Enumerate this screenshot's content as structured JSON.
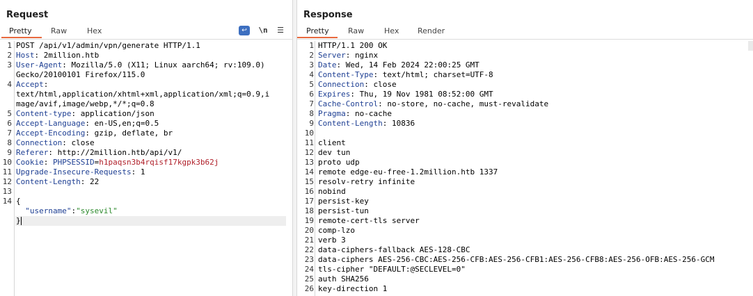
{
  "request": {
    "title": "Request",
    "tabs": [
      "Pretty",
      "Raw",
      "Hex"
    ],
    "active_tab": "Pretty",
    "tools": {
      "wrap_icon": "word-wrap-icon",
      "newline_label": "\\n",
      "menu_icon": "hamburger-menu-icon"
    },
    "lines": [
      {
        "n": "1",
        "text": "POST /api/v1/admin/vpn/generate HTTP/1.1"
      },
      {
        "n": "2",
        "key": "Host",
        "val": "2million.htb"
      },
      {
        "n": "3",
        "key": "User-Agent",
        "val": "Mozilla/5.0 (X11; Linux aarch64; rv:109.0)"
      },
      {
        "n": "",
        "text": "Gecko/20100101 Firefox/115.0"
      },
      {
        "n": "4",
        "key": "Accept",
        "val": ""
      },
      {
        "n": "",
        "text": "text/html,application/xhtml+xml,application/xml;q=0.9,i"
      },
      {
        "n": "",
        "text": "mage/avif,image/webp,*/*;q=0.8"
      },
      {
        "n": "5",
        "key": "Content-type",
        "val": "application/json"
      },
      {
        "n": "6",
        "key": "Accept-Language",
        "val": "en-US,en;q=0.5"
      },
      {
        "n": "7",
        "key": "Accept-Encoding",
        "val": "gzip, deflate, br"
      },
      {
        "n": "8",
        "key": "Connection",
        "val": "close"
      },
      {
        "n": "9",
        "key": "Referer",
        "val": "http://2million.htb/api/v1/"
      },
      {
        "n": "10",
        "key": "Cookie",
        "cookie_name": "PHPSESSID",
        "cookie_val": "h1paqsn3b4rqisf17kgpk3b62j"
      },
      {
        "n": "11",
        "key": "Upgrade-Insecure-Requests",
        "val": "1"
      },
      {
        "n": "12",
        "key": "Content-Length",
        "val": "22"
      },
      {
        "n": "13",
        "text": ""
      },
      {
        "n": "14",
        "text": "{"
      },
      {
        "n": "",
        "json_key": "\"username\"",
        "json_val": "\"sysevil\""
      },
      {
        "n": "",
        "text": "}"
      }
    ]
  },
  "response": {
    "title": "Response",
    "tabs": [
      "Pretty",
      "Raw",
      "Hex",
      "Render"
    ],
    "active_tab": "Pretty",
    "lines": [
      {
        "n": "1",
        "text": "HTTP/1.1 200 OK"
      },
      {
        "n": "2",
        "key": "Server",
        "val": "nginx"
      },
      {
        "n": "3",
        "key": "Date",
        "val": "Wed, 14 Feb 2024 22:00:25 GMT"
      },
      {
        "n": "4",
        "key": "Content-Type",
        "val": "text/html; charset=UTF-8"
      },
      {
        "n": "5",
        "key": "Connection",
        "val": "close"
      },
      {
        "n": "6",
        "key": "Expires",
        "val": "Thu, 19 Nov 1981 08:52:00 GMT"
      },
      {
        "n": "7",
        "key": "Cache-Control",
        "val": "no-store, no-cache, must-revalidate"
      },
      {
        "n": "8",
        "key": "Pragma",
        "val": "no-cache"
      },
      {
        "n": "9",
        "key": "Content-Length",
        "val": "10836"
      },
      {
        "n": "10",
        "text": ""
      },
      {
        "n": "11",
        "text": "client"
      },
      {
        "n": "12",
        "text": "dev tun"
      },
      {
        "n": "13",
        "text": "proto udp"
      },
      {
        "n": "14",
        "text": "remote edge-eu-free-1.2million.htb 1337"
      },
      {
        "n": "15",
        "text": "resolv-retry infinite"
      },
      {
        "n": "16",
        "text": "nobind"
      },
      {
        "n": "17",
        "text": "persist-key"
      },
      {
        "n": "18",
        "text": "persist-tun"
      },
      {
        "n": "19",
        "text": "remote-cert-tls server"
      },
      {
        "n": "20",
        "text": "comp-lzo"
      },
      {
        "n": "21",
        "text": "verb 3"
      },
      {
        "n": "22",
        "text": "data-ciphers-fallback AES-128-CBC"
      },
      {
        "n": "23",
        "text": "data-ciphers AES-256-CBC:AES-256-CFB:AES-256-CFB1:AES-256-CFB8:AES-256-OFB:AES-256-GCM"
      },
      {
        "n": "24",
        "text": "tls-cipher \"DEFAULT:@SECLEVEL=0\""
      },
      {
        "n": "25",
        "text": "auth SHA256"
      },
      {
        "n": "26",
        "text": "key-direction 1"
      }
    ]
  }
}
